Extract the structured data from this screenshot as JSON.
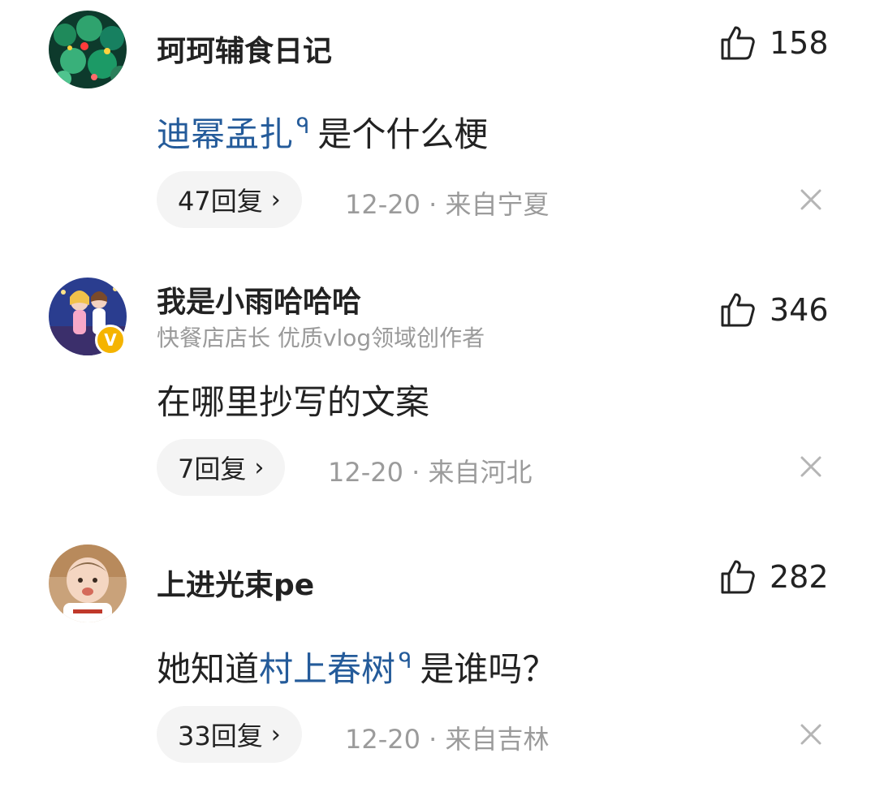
{
  "comments": [
    {
      "username": "珂珂辅食日记",
      "subtitle": "",
      "content_link": "迪幂孟扎",
      "content_text": "是个什么梗",
      "content_prefix": "",
      "replies": "47回复",
      "meta": "12-20 · 来自宁夏",
      "likes": "158"
    },
    {
      "username": "我是小雨哈哈哈",
      "subtitle": "快餐店店长 优质vlog领域创作者",
      "verified_badge": "V",
      "content_prefix": "在哪里抄写的文案",
      "content_link": "",
      "content_text": "",
      "replies": "7回复",
      "meta": "12-20 · 来自河北",
      "likes": "346"
    },
    {
      "username": "上进光束pe",
      "subtitle": "",
      "content_prefix": "她知道",
      "content_link": "村上春树",
      "content_text": "是谁吗？",
      "replies": "33回复",
      "meta": "12-20 · 来自吉林",
      "likes": "282"
    }
  ],
  "icons": {
    "like": "thumbs-up-icon",
    "close": "close-icon",
    "chevron": "chevron-right-icon",
    "search_hint": "search-hint-icon"
  },
  "colors": {
    "link": "#245b9a",
    "meta": "#9b9b9b",
    "reply_bg": "#f4f4f4",
    "badge": "#f5b400"
  }
}
